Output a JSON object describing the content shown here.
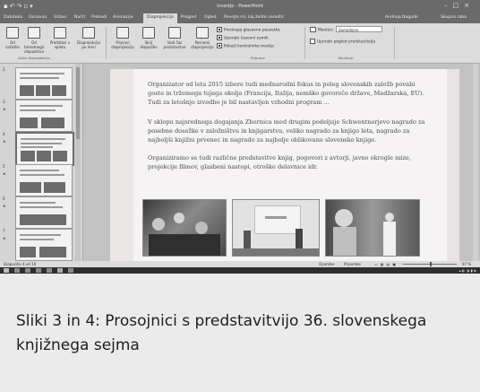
{
  "app": {
    "title": "Izvestje - PowerPoint",
    "quick_access_icons": [
      "save-icon",
      "undo-icon",
      "redo-icon",
      "start-icon",
      "customize-icon"
    ],
    "window_controls": [
      "minimize-icon",
      "maximize-icon",
      "close-icon"
    ]
  },
  "tabs": [
    {
      "label": "Datoteka"
    },
    {
      "label": "Osnovno"
    },
    {
      "label": "Vstavi"
    },
    {
      "label": "Načrt"
    },
    {
      "label": "Prehodi"
    },
    {
      "label": "Animacije"
    },
    {
      "label": "Diaprojekcija",
      "active": true
    },
    {
      "label": "Pregled"
    },
    {
      "label": "Ogled"
    },
    {
      "label": "Povejte mi, kaj želite narediti"
    }
  ],
  "account": {
    "user": "Andreja Nagode",
    "share": "Skupna raba"
  },
  "ribbon": {
    "buttons": [
      {
        "label": "Od začetka",
        "icon": "play-from-start-icon"
      },
      {
        "label": "Od trenutnega diapozitiva",
        "icon": "play-current-icon"
      },
      {
        "label": "Predstavi v spletu",
        "icon": "present-online-icon"
      },
      {
        "label": "Diaprojekcija po meri",
        "icon": "custom-show-icon"
      },
      {
        "label": "Pripravi diaprojekcijo",
        "icon": "setup-show-icon"
      },
      {
        "label": "Skrij diapozitiv",
        "icon": "hide-slide-icon"
      },
      {
        "label": "Vadi čas predstavitve",
        "icon": "rehearse-timings-icon"
      },
      {
        "label": "Posnemi diaprojekcijo",
        "icon": "record-show-icon"
      }
    ],
    "checks": [
      {
        "label": "Predvajaj glasovne posnetke",
        "checked": true
      },
      {
        "label": "Uporabi časovni zamik",
        "checked": true
      },
      {
        "label": "Pokaži kontrolnike medija",
        "checked": true
      }
    ],
    "monitor": {
      "label": "Monitor:",
      "value": "Samodejno"
    },
    "presenter_view": {
      "label": "Uporabi pogled predstavitelja",
      "checked": false
    },
    "groups": [
      "Začni diaprojekcijo",
      "Priprava",
      "Monitorji"
    ]
  },
  "thumbnails": [
    {
      "num": "2",
      "selected": false
    },
    {
      "num": "3",
      "selected": false
    },
    {
      "num": "4",
      "selected": true
    },
    {
      "num": "5",
      "selected": false
    },
    {
      "num": "6",
      "selected": false
    },
    {
      "num": "7",
      "selected": false
    }
  ],
  "slide": {
    "paragraphs": [
      [
        "Organizator od leta 2015 izbere tudi mednarodni fokus in poleg slovenskih založb povabi",
        "goste in tržemega tujega okolja (Francija, Italija, nemško govoreče države, Madžarska, EU).",
        "Tudi za letošnjo izvedbo je bil nastavljen vzhodni program ..."
      ],
      [
        "V sklopu najsrednega dogajanja Zbornica med drugim podeljuje Schwentnerjevo nagrado za",
        "posebne dosežke v založništvu in knjigarstvu, veliko nagrado za knjigo leta, nagrado za",
        "najboljši knjižni prvenec in nagrado za najbolje oblikovane slovenske knjige."
      ],
      [
        "Organiziramo se tudi različne predstavitve knjig, pogovori z avtorji, javne okrogle mize,",
        "projekcije filmov, glasbeni nastopi, otroške delavnice idr."
      ]
    ]
  },
  "status": {
    "slide_counter": "Diapozitiv 4 od 10",
    "notes": "Opombe",
    "comments": "Pripombe",
    "zoom": "97 %"
  },
  "caption": {
    "line1": "Sliki 3 in 4: Prosojnici s predstavitvijo 36. slovenskega",
    "line2": "knjižnega sejma"
  }
}
